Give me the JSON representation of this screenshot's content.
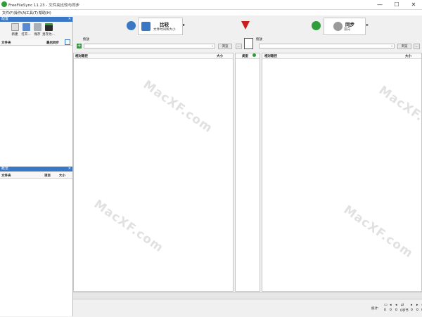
{
  "window": {
    "title": "FreeFileSync 11.23 - 文件夹比较与同步",
    "controls": [
      "—",
      "☐",
      "✕"
    ]
  },
  "menu": [
    "文件(F)",
    "操作(A)",
    "工具(T)",
    "帮助(H)"
  ],
  "session_panel": {
    "title": "配置",
    "tools": [
      {
        "label": "新建",
        "icon": "new-icon"
      },
      {
        "label": "打开...",
        "icon": "open-icon"
      },
      {
        "label": "保存",
        "icon": "save-icon"
      },
      {
        "label": "另存为...",
        "icon": "save-as-icon"
      }
    ],
    "columns": {
      "name": "文件夹",
      "last_sync": "最后同步"
    }
  },
  "sync_panel": {
    "title": "概览",
    "columns": {
      "name": "文件夹",
      "items": "项目",
      "size": "大小"
    }
  },
  "toolbar": {
    "compare": {
      "title": "比较",
      "subtitle": "文件时间和大小"
    },
    "sync": {
      "title": "同步",
      "subtitle": "双向"
    }
  },
  "left_folder": {
    "label": "拖放",
    "path": "",
    "browse": "浏览"
  },
  "right_folder": {
    "label": "拖放",
    "path": "",
    "browse": "浏览"
  },
  "left_grid": {
    "col_path": "相对路径",
    "col_size": "大小"
  },
  "middle_grid": {
    "col_cat": "类型"
  },
  "right_grid": {
    "col_path": "相对路径",
    "col_size": "大小"
  },
  "status": {
    "label": "统计:",
    "counts": [
      "0",
      "0",
      "0",
      "0字节",
      "0",
      "0",
      "0"
    ]
  },
  "watermark": "MacXF.com",
  "colors": {
    "accent": "#3a78c6",
    "gear": "#2e9d3a",
    "filter": "#c81e1e"
  }
}
